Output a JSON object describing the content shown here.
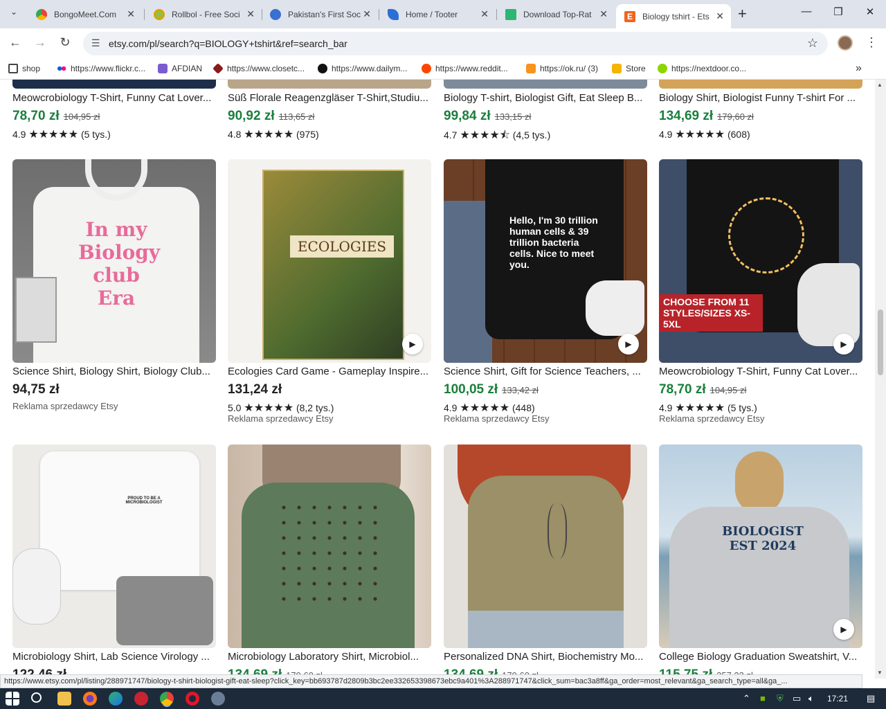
{
  "browser": {
    "tabs": [
      {
        "title": "BongoMeet.Com",
        "favicon_color": "#e8453c"
      },
      {
        "title": "Rollbol - Free Soci",
        "favicon_color": "#8bc34a"
      },
      {
        "title": "Pakistan's First Soc",
        "favicon_color": "#3b6fd1"
      },
      {
        "title": "Home / Tooter",
        "favicon_color": "#2a6fd6"
      },
      {
        "title": "Download Top-Rat",
        "favicon_color": "#2bb673"
      },
      {
        "title": "Biology tshirt - Ets",
        "favicon_color": "#f1641e",
        "active": true
      }
    ],
    "new_tab_label": "+",
    "url": "etsy.com/pl/search?q=BIOLOGY+tshirt&ref=search_bar",
    "bookmarks": [
      {
        "label": "shop",
        "color": "#444"
      },
      {
        "label": "https://www.flickr.c...",
        "color": "#ff0084"
      },
      {
        "label": "AFDIAN",
        "color": "#7b5ccf"
      },
      {
        "label": "https://www.closetc...",
        "color": "#8b1a1a"
      },
      {
        "label": "https://www.dailym...",
        "color": "#111"
      },
      {
        "label": "https://www.reddit...",
        "color": "#ff4500"
      },
      {
        "label": "https://ok.ru/ (3)",
        "color": "#f7931e"
      },
      {
        "label": "Store",
        "color": "#f5b400"
      },
      {
        "label": "https://nextdoor.co...",
        "color": "#8ed500"
      }
    ]
  },
  "colors": {
    "sale_green": "#1a7f3c",
    "price_black": "#222222",
    "etsy_orange": "#f1641e"
  },
  "listings_top": [
    {
      "title": "Meowcrobiology T-Shirt, Funny Cat Lover...",
      "price": "78,70 zł",
      "old_price": "104,95 zł",
      "rating": "4.9",
      "stars": "★★★★★",
      "reviews": "(5 tys.)"
    },
    {
      "title": "Süß Florale Reagenzgläser T-Shirt,Studiu...",
      "price": "90,92 zł",
      "old_price": "113,65 zł",
      "rating": "4.8",
      "stars": "★★★★★",
      "reviews": "(975)"
    },
    {
      "title": "Biology T-shirt, Biologist Gift, Eat Sleep B...",
      "price": "99,84 zł",
      "old_price": "133,15 zł",
      "rating": "4.7",
      "stars": "★★★★⯪",
      "reviews": "(4,5 tys.)"
    },
    {
      "title": "Biology Shirt, Biologist Funny T-shirt For ...",
      "price": "134,69 zł",
      "old_price": "179,60 zł",
      "rating": "4.9",
      "stars": "★★★★★",
      "reviews": "(608)"
    }
  ],
  "listings_mid": [
    {
      "title": "Science Shirt, Biology Shirt, Biology Club...",
      "price": "94,75 zł",
      "old_price": "",
      "rating": "",
      "stars": "",
      "reviews": "",
      "ad": "Reklama sprzedawcy Etsy",
      "video": false,
      "img_text": "In my Biology club Era"
    },
    {
      "title": "Ecologies Card Game - Gameplay Inspire...",
      "price": "131,24 zł",
      "old_price": "",
      "rating": "5.0",
      "stars": "★★★★★",
      "reviews": "(8,2 tys.)",
      "ad": "Reklama sprzedawcy Etsy",
      "video": true,
      "img_text": "ECOLOGIES"
    },
    {
      "title": "Science Shirt, Gift for Science Teachers, ...",
      "price": "100,05 zł",
      "old_price": "133,42 zł",
      "rating": "4.9",
      "stars": "★★★★★",
      "reviews": "(448)",
      "ad": "Reklama sprzedawcy Etsy",
      "video": true,
      "img_text": "Hello, I'm 30 trillion human cells & 39 trillion bacteria cells. Nice to meet you."
    },
    {
      "title": "Meowcrobiology T-Shirt, Funny Cat Lover...",
      "price": "78,70 zł",
      "old_price": "104,95 zł",
      "rating": "4.9",
      "stars": "★★★★★",
      "reviews": "(5 tys.)",
      "ad": "Reklama sprzedawcy Etsy",
      "video": true,
      "img_text": "CHOOSE FROM 11 STYLES/SIZES XS-5XL"
    }
  ],
  "listings_bottom": [
    {
      "title": "Microbiology Shirt, Lab Science Virology ...",
      "price": "122,46 zł",
      "old_price": "",
      "video": false,
      "img_text": "PROUD TO BE A MICROBIOLOGIST"
    },
    {
      "title": "Microbiology Laboratory Shirt, Microbiol...",
      "price": "134,69 zł",
      "old_price": "179,60 zł",
      "video": false,
      "img_text": ""
    },
    {
      "title": "Personalized DNA Shirt, Biochemistry Mo...",
      "price": "134,69 zł",
      "old_price": "179,60 zł",
      "video": false,
      "img_text": ""
    },
    {
      "title": "College Biology Graduation Sweatshirt, V...",
      "price": "115,75 zł",
      "old_price": "257,23 zł",
      "video": true,
      "img_text": "BIOLOGIST EST 2024"
    }
  ],
  "status_url": "https://www.etsy.com/pl/listing/288971747/biology-t-shirt-biologist-gift-eat-sleep?click_key=bb693787d2809b3bc2ee332653398673ebc9a401%3A288971747&click_sum=bac3a8ff&ga_order=most_relevant&ga_search_type=all&ga_...",
  "taskbar": {
    "time": "17:21"
  }
}
